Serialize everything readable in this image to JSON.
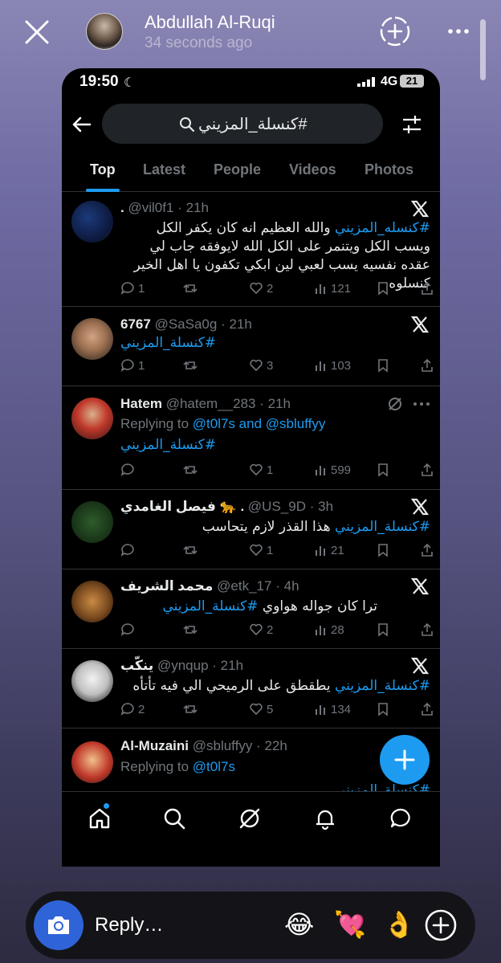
{
  "story": {
    "user_name": "Abdullah Al-Ruqi",
    "time_ago": "34 seconds ago"
  },
  "status_bar": {
    "time": "19:50",
    "network": "4G",
    "battery": "21"
  },
  "search": {
    "query": "#كنسلة_المزيني"
  },
  "tabs": [
    "Top",
    "Latest",
    "People",
    "Videos",
    "Photos"
  ],
  "tweets": [
    {
      "name": ".",
      "handle": "@vil0f1",
      "time": "21h",
      "tag": "#كنسله_المزيني",
      "text": " والله العظيم انه كان يكفر الكل ويسب الكل ويتنمر على الكل الله لايوفقه جاب لي عقده نفسيه يسب لعبي لين ابكي تكفون يا اهل الخير كنسلوه",
      "replies": "1",
      "retweets": "",
      "likes": "2",
      "views": "121"
    },
    {
      "name": "6767",
      "handle": "@SaSa0g",
      "time": "21h",
      "tag": "#كنسلة_المزيني",
      "text": "",
      "replies": "1",
      "retweets": "",
      "likes": "3",
      "views": "103"
    },
    {
      "name": "Hatem",
      "handle": "@hatem__283",
      "time": "21h",
      "replying_prefix": "Replying to",
      "replying_to": "@t0l7s and @sbluffyy",
      "tag": "#كنسلة_المزيني",
      "text": "",
      "replies": "",
      "retweets": "",
      "likes": "1",
      "views": "599"
    },
    {
      "name": "فيصل الغامدي 🐆 .",
      "handle": "@US_9D",
      "time": "3h",
      "tag": "#كنسلة_المزيني",
      "text": " هذا القذر لازم يتحاسب",
      "replies": "",
      "retweets": "",
      "likes": "1",
      "views": "21"
    },
    {
      "name": "محمد الشريف",
      "handle": "@etk_17",
      "time": "4h",
      "tag": "#كنسلة_المزيني",
      "text": "ترا كان جواله هواوي ",
      "replies": "",
      "retweets": "",
      "likes": "2",
      "views": "28"
    },
    {
      "name": "ينكّب",
      "handle": "@ynqup",
      "time": "21h",
      "tag": "#كنسلة_المزيني",
      "text": " يطقطق على الرميحي الي فيه تأتأه",
      "replies": "2",
      "retweets": "",
      "likes": "5",
      "views": "134"
    },
    {
      "name": "Al-Muzaini",
      "handle": "@sbluffyy",
      "time": "22h",
      "replying_prefix": "Replying to",
      "replying_to": "@t0l7s",
      "tag": "#كنسلة_المزيني",
      "text": ""
    }
  ],
  "reply_bar": {
    "placeholder": "Reply…",
    "emojis": [
      "😂",
      "💘",
      "👌"
    ]
  },
  "colors": {
    "accent": "#1d9bf0",
    "background": "#000000"
  }
}
